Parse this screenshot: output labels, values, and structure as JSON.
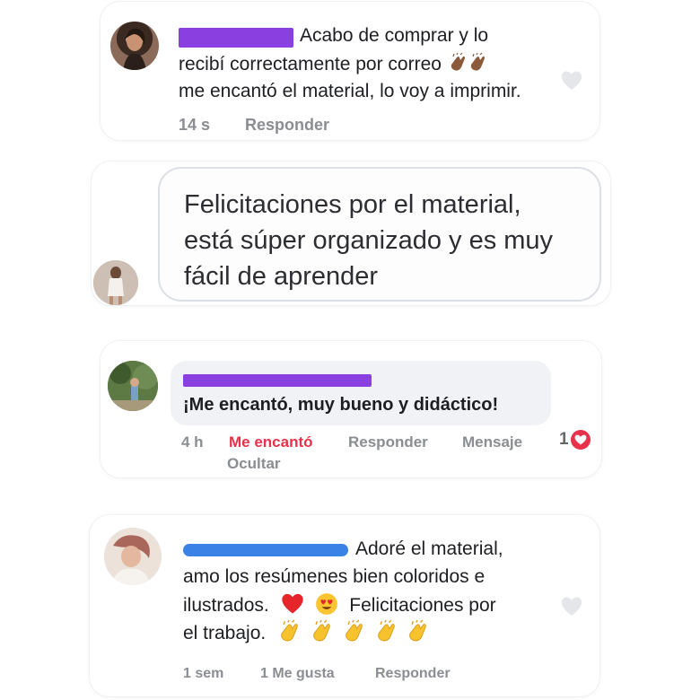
{
  "comments": [
    {
      "text_lines": [
        "Acabo de comprar y lo",
        "recibí  correctamente por correo",
        "me encantó el material, lo voy a imprimir."
      ],
      "emojis": [
        "clapping-hands-dark",
        "clapping-hands-dark"
      ],
      "time": "14 s",
      "reply": "Responder"
    },
    {
      "text_lines": [
        "Felicitaciones por el material,",
        "está súper organizado y es muy",
        "fácil de aprender"
      ]
    },
    {
      "text": "¡Me encantó, muy bueno y didáctico!",
      "time": "4 h",
      "reaction_label": "Me encantó",
      "reply": "Responder",
      "message": "Mensaje",
      "hide": "Ocultar",
      "reaction_count": "1"
    },
    {
      "text_lines": [
        "Adoré el material,",
        "amo los resúmenes bien coloridos e",
        "ilustrados.",
        "Felicitaciones por",
        "el trabajo."
      ],
      "emojis": [
        "red-heart",
        "heart-eyes-face",
        "clapping-hands",
        "clapping-hands",
        "clapping-hands",
        "clapping-hands",
        "clapping-hands"
      ],
      "time": "1 sem",
      "likes": "1 Me gusta",
      "reply": "Responder"
    }
  ],
  "colors": {
    "redact_purple": "#8a3fe0",
    "redact_blue": "#3b82e6",
    "love_red": "#e8314a",
    "meta_gray": "#8a8d91"
  }
}
